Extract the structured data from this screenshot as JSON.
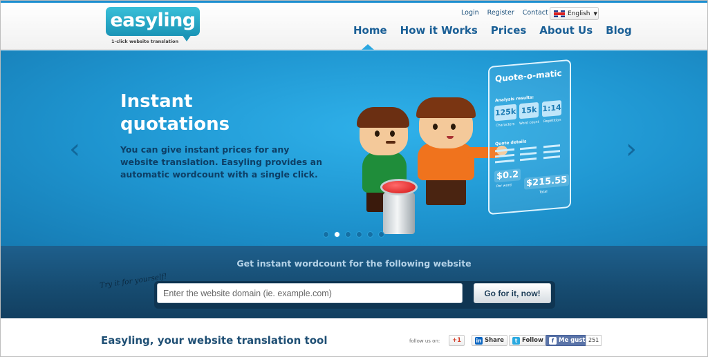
{
  "logo": {
    "text": "easyling",
    "tagline": "1-click website translation"
  },
  "toplinks": {
    "login": "Login",
    "register": "Register",
    "contact": "Contact Us"
  },
  "language": {
    "selected": "English"
  },
  "nav": {
    "items": [
      "Home",
      "How it Works",
      "Prices",
      "About Us",
      "Blog"
    ],
    "active_index": 0
  },
  "hero": {
    "title_line1": "Instant",
    "title_line2": "quotations",
    "description": "You can give instant prices for any website translation. Easyling provides an automatic wordcount with a single click.",
    "slide_count": 6,
    "active_slide": 1
  },
  "quote_panel": {
    "title": "Quote-o-matic",
    "analysis_label": "Analysis results:",
    "stats": [
      {
        "value": "125k",
        "label": "Characters"
      },
      {
        "value": "15k",
        "label": "Word count"
      },
      {
        "value": "1:14",
        "label": "Repetition"
      }
    ],
    "details_label": "Quote details",
    "per_word_value": "$0.2",
    "per_word_label": "Per word",
    "total_value": "$215.55",
    "total_label": "Total"
  },
  "search": {
    "heading": "Get instant wordcount for the following website",
    "try_it": "Try it for yourself!",
    "placeholder": "Enter the website domain (ie. example.com)",
    "button_label": "Go for it, now!"
  },
  "footer": {
    "title": "Easyling, your website translation tool",
    "follow_label": "follow us on:",
    "social": {
      "gplus": "+1",
      "linkedin": "Share",
      "twitter": "Follow",
      "facebook": "Me gusta",
      "facebook_count": "251"
    }
  },
  "colors": {
    "brand": "#1e94cf",
    "nav_text": "#1a5f96",
    "band": "#164b70"
  }
}
